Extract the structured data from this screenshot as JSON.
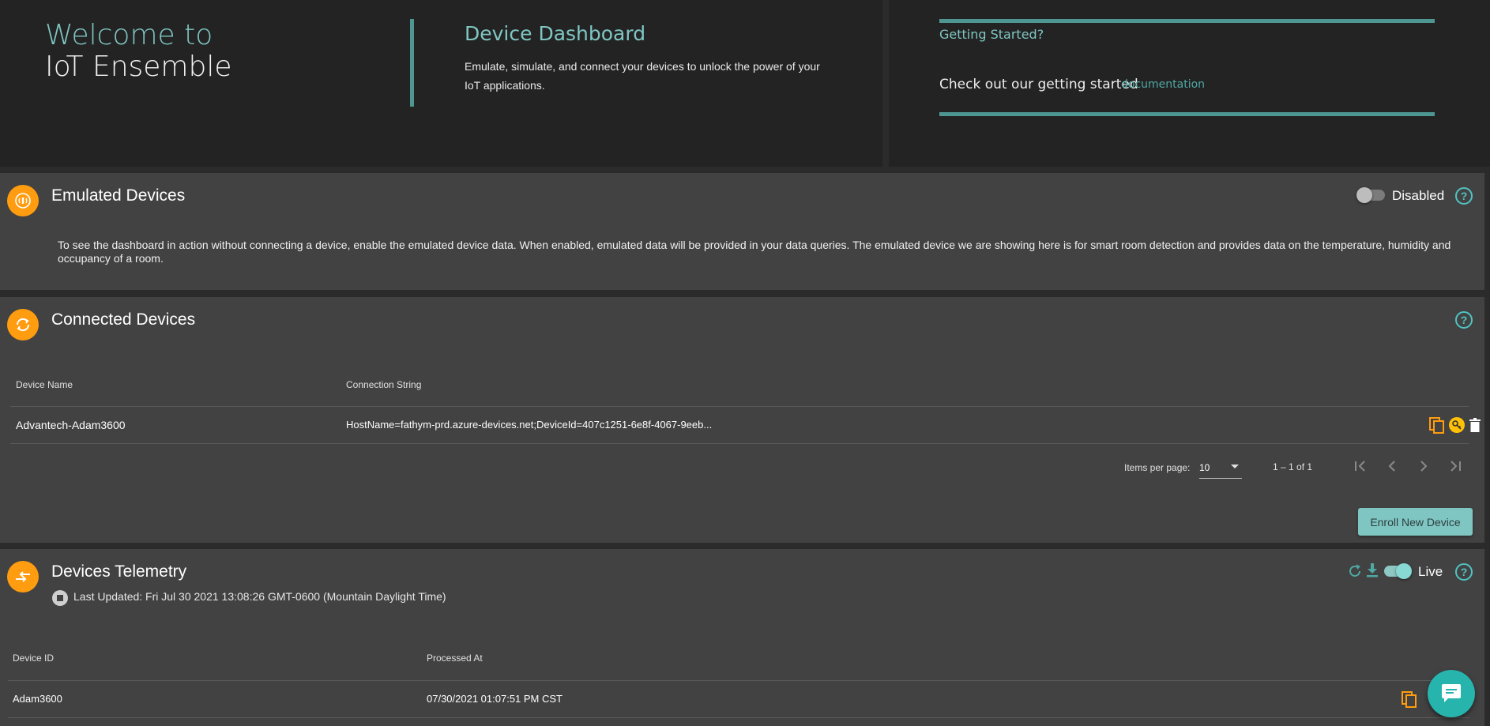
{
  "hero": {
    "welcome_line1": "Welcome to",
    "welcome_line2": "IoT Ensemble",
    "dashboard_title": "Device Dashboard",
    "dashboard_desc": "Emulate, simulate, and connect your devices to unlock the power of your IoT applications.",
    "getting_started_title": "Getting Started?",
    "getting_started_text": "Check out our getting started",
    "getting_started_link": "documentation"
  },
  "emulated": {
    "icon": "sensor-waves-icon",
    "title": "Emulated Devices",
    "toggle_label": "Disabled",
    "toggle_on": false,
    "description": "To see the dashboard in action without connecting a device, enable the emulated device data. When enabled, emulated data will be provided in your data queries. The emulated device we are showing here is for smart room detection and provides data on the temperature, humidity and occupancy of a room."
  },
  "connected": {
    "icon": "sync-icon",
    "title": "Connected Devices",
    "columns": [
      "Device Name",
      "Connection String"
    ],
    "rows": [
      {
        "name": "Advantech-Adam3600",
        "connection": "HostName=fathym-prd.azure-devices.net;DeviceId=407c1251-6e8f-4067-9eeb..."
      }
    ],
    "paginator": {
      "items_per_page_label": "Items per page:",
      "items_per_page": "10",
      "range": "1 – 1 of 1"
    },
    "enroll_button": "Enroll New Device"
  },
  "telemetry": {
    "icon": "swap-arrows-icon",
    "title": "Devices Telemetry",
    "last_updated": "Last Updated: Fri Jul 30 2021 13:08:26 GMT-0600 (Mountain Daylight Time)",
    "live_label": "Live",
    "live_on": true,
    "columns": [
      "Device ID",
      "Processed At"
    ],
    "rows": [
      {
        "device_id": "Adam3600",
        "processed_at": "07/30/2021 01:07:51 PM CST"
      }
    ]
  },
  "colors": {
    "accent_teal": "#7fc6c3",
    "accent_orange": "#ff9c0f",
    "panel_bg": "#424242",
    "hero_bg": "#232323"
  }
}
